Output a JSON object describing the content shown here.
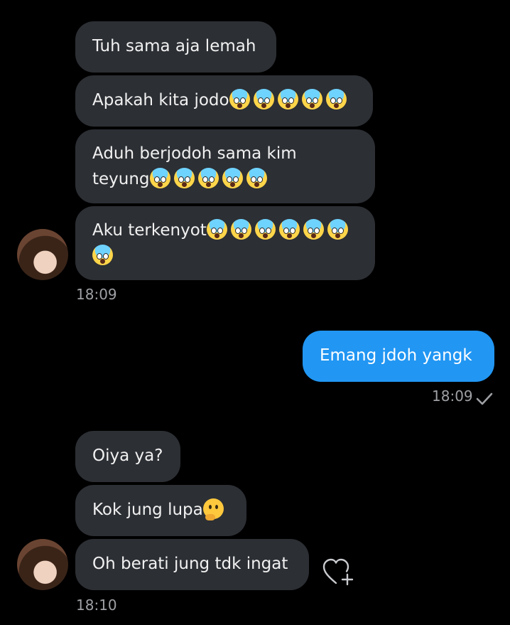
{
  "chat": {
    "group1": {
      "messages": [
        {
          "text": "Tuh sama aja lemah"
        },
        {
          "text": "Apakah kita jodo"
        },
        {
          "text": "Aduh berjodoh sama kim"
        },
        {
          "text": "teyung"
        },
        {
          "text": "Aku terkenyot"
        }
      ],
      "time": "18:09"
    },
    "sent": {
      "text": "Emang jdoh yangk",
      "time": "18:09",
      "status": "read"
    },
    "group2": {
      "messages": [
        {
          "text": "Oiya ya?"
        },
        {
          "text": "Kok jung lupa"
        },
        {
          "text": "Oh berati jung tdk ingat"
        }
      ],
      "time": "18:10"
    }
  },
  "icons": {
    "scream": "face-screaming-in-fear-emoji",
    "thinking": "thinking-face-emoji",
    "read_check": "check-icon",
    "react_heart": "heart-plus-icon"
  },
  "colors": {
    "background": "#000000",
    "received_bubble": "#2c2f34",
    "sent_bubble": "#2196f3",
    "timestamp": "#9ea0a4"
  }
}
